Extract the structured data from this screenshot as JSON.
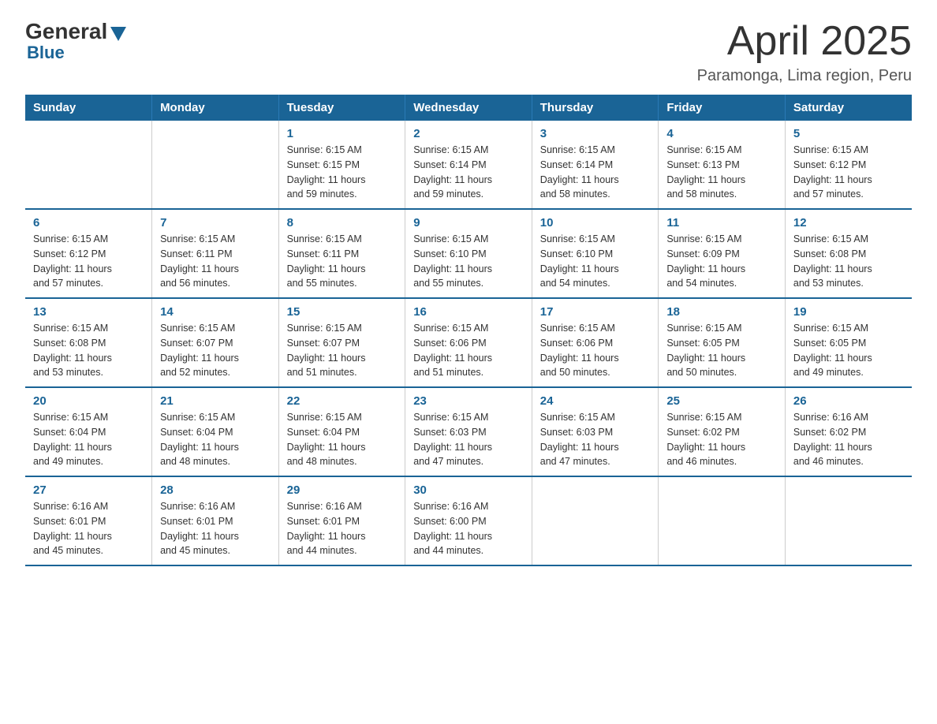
{
  "logo": {
    "general": "General",
    "blue": "Blue"
  },
  "title": "April 2025",
  "location": "Paramonga, Lima region, Peru",
  "days_header": [
    "Sunday",
    "Monday",
    "Tuesday",
    "Wednesday",
    "Thursday",
    "Friday",
    "Saturday"
  ],
  "weeks": [
    [
      {
        "day": "",
        "info": ""
      },
      {
        "day": "",
        "info": ""
      },
      {
        "day": "1",
        "info": "Sunrise: 6:15 AM\nSunset: 6:15 PM\nDaylight: 11 hours\nand 59 minutes."
      },
      {
        "day": "2",
        "info": "Sunrise: 6:15 AM\nSunset: 6:14 PM\nDaylight: 11 hours\nand 59 minutes."
      },
      {
        "day": "3",
        "info": "Sunrise: 6:15 AM\nSunset: 6:14 PM\nDaylight: 11 hours\nand 58 minutes."
      },
      {
        "day": "4",
        "info": "Sunrise: 6:15 AM\nSunset: 6:13 PM\nDaylight: 11 hours\nand 58 minutes."
      },
      {
        "day": "5",
        "info": "Sunrise: 6:15 AM\nSunset: 6:12 PM\nDaylight: 11 hours\nand 57 minutes."
      }
    ],
    [
      {
        "day": "6",
        "info": "Sunrise: 6:15 AM\nSunset: 6:12 PM\nDaylight: 11 hours\nand 57 minutes."
      },
      {
        "day": "7",
        "info": "Sunrise: 6:15 AM\nSunset: 6:11 PM\nDaylight: 11 hours\nand 56 minutes."
      },
      {
        "day": "8",
        "info": "Sunrise: 6:15 AM\nSunset: 6:11 PM\nDaylight: 11 hours\nand 55 minutes."
      },
      {
        "day": "9",
        "info": "Sunrise: 6:15 AM\nSunset: 6:10 PM\nDaylight: 11 hours\nand 55 minutes."
      },
      {
        "day": "10",
        "info": "Sunrise: 6:15 AM\nSunset: 6:10 PM\nDaylight: 11 hours\nand 54 minutes."
      },
      {
        "day": "11",
        "info": "Sunrise: 6:15 AM\nSunset: 6:09 PM\nDaylight: 11 hours\nand 54 minutes."
      },
      {
        "day": "12",
        "info": "Sunrise: 6:15 AM\nSunset: 6:08 PM\nDaylight: 11 hours\nand 53 minutes."
      }
    ],
    [
      {
        "day": "13",
        "info": "Sunrise: 6:15 AM\nSunset: 6:08 PM\nDaylight: 11 hours\nand 53 minutes."
      },
      {
        "day": "14",
        "info": "Sunrise: 6:15 AM\nSunset: 6:07 PM\nDaylight: 11 hours\nand 52 minutes."
      },
      {
        "day": "15",
        "info": "Sunrise: 6:15 AM\nSunset: 6:07 PM\nDaylight: 11 hours\nand 51 minutes."
      },
      {
        "day": "16",
        "info": "Sunrise: 6:15 AM\nSunset: 6:06 PM\nDaylight: 11 hours\nand 51 minutes."
      },
      {
        "day": "17",
        "info": "Sunrise: 6:15 AM\nSunset: 6:06 PM\nDaylight: 11 hours\nand 50 minutes."
      },
      {
        "day": "18",
        "info": "Sunrise: 6:15 AM\nSunset: 6:05 PM\nDaylight: 11 hours\nand 50 minutes."
      },
      {
        "day": "19",
        "info": "Sunrise: 6:15 AM\nSunset: 6:05 PM\nDaylight: 11 hours\nand 49 minutes."
      }
    ],
    [
      {
        "day": "20",
        "info": "Sunrise: 6:15 AM\nSunset: 6:04 PM\nDaylight: 11 hours\nand 49 minutes."
      },
      {
        "day": "21",
        "info": "Sunrise: 6:15 AM\nSunset: 6:04 PM\nDaylight: 11 hours\nand 48 minutes."
      },
      {
        "day": "22",
        "info": "Sunrise: 6:15 AM\nSunset: 6:04 PM\nDaylight: 11 hours\nand 48 minutes."
      },
      {
        "day": "23",
        "info": "Sunrise: 6:15 AM\nSunset: 6:03 PM\nDaylight: 11 hours\nand 47 minutes."
      },
      {
        "day": "24",
        "info": "Sunrise: 6:15 AM\nSunset: 6:03 PM\nDaylight: 11 hours\nand 47 minutes."
      },
      {
        "day": "25",
        "info": "Sunrise: 6:15 AM\nSunset: 6:02 PM\nDaylight: 11 hours\nand 46 minutes."
      },
      {
        "day": "26",
        "info": "Sunrise: 6:16 AM\nSunset: 6:02 PM\nDaylight: 11 hours\nand 46 minutes."
      }
    ],
    [
      {
        "day": "27",
        "info": "Sunrise: 6:16 AM\nSunset: 6:01 PM\nDaylight: 11 hours\nand 45 minutes."
      },
      {
        "day": "28",
        "info": "Sunrise: 6:16 AM\nSunset: 6:01 PM\nDaylight: 11 hours\nand 45 minutes."
      },
      {
        "day": "29",
        "info": "Sunrise: 6:16 AM\nSunset: 6:01 PM\nDaylight: 11 hours\nand 44 minutes."
      },
      {
        "day": "30",
        "info": "Sunrise: 6:16 AM\nSunset: 6:00 PM\nDaylight: 11 hours\nand 44 minutes."
      },
      {
        "day": "",
        "info": ""
      },
      {
        "day": "",
        "info": ""
      },
      {
        "day": "",
        "info": ""
      }
    ]
  ]
}
